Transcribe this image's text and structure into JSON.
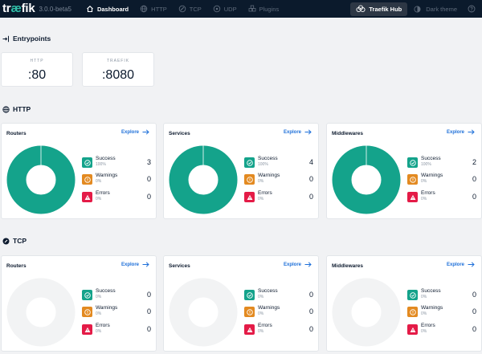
{
  "app": {
    "logo_main": "tr",
    "logo_accent": "æ",
    "logo_rest": "fik",
    "version": "3.0.0-beta5"
  },
  "nav": [
    {
      "label": "Dashboard",
      "icon": "home-icon",
      "active": true
    },
    {
      "label": "HTTP",
      "icon": "globe-icon",
      "active": false
    },
    {
      "label": "TCP",
      "icon": "tcp-icon",
      "active": false
    },
    {
      "label": "UDP",
      "icon": "udp-icon",
      "active": false
    },
    {
      "label": "Plugins",
      "icon": "plugins-icon",
      "active": false
    }
  ],
  "right_nav": {
    "hub_label": "Traefik Hub",
    "theme_label": "Dark theme",
    "help_icon": "help-icon"
  },
  "entrypoints": {
    "title": "Entrypoints",
    "items": [
      {
        "name": "HTTP",
        "value": ":80"
      },
      {
        "name": "TRAEFIK",
        "value": ":8080"
      }
    ]
  },
  "http": {
    "title": "HTTP",
    "cards": [
      {
        "title": "Routers",
        "explore": "Explore",
        "success": 3,
        "warnings": 0,
        "errors": 0,
        "success_pct": "100%",
        "warnings_pct": "0%",
        "errors_pct": "0%",
        "success_ratio": 1.0
      },
      {
        "title": "Services",
        "explore": "Explore",
        "success": 4,
        "warnings": 0,
        "errors": 0,
        "success_pct": "100%",
        "warnings_pct": "0%",
        "errors_pct": "0%",
        "success_ratio": 1.0
      },
      {
        "title": "Middlewares",
        "explore": "Explore",
        "success": 2,
        "warnings": 0,
        "errors": 0,
        "success_pct": "100%",
        "warnings_pct": "0%",
        "errors_pct": "0%",
        "success_ratio": 1.0
      }
    ]
  },
  "tcp": {
    "title": "TCP",
    "cards": [
      {
        "title": "Routers",
        "explore": "Explore",
        "success": 0,
        "warnings": 0,
        "errors": 0,
        "success_pct": "0%",
        "warnings_pct": "0%",
        "errors_pct": "0%",
        "success_ratio": 0.0
      },
      {
        "title": "Services",
        "explore": "Explore",
        "success": 0,
        "warnings": 0,
        "errors": 0,
        "success_pct": "0%",
        "warnings_pct": "0%",
        "errors_pct": "0%",
        "success_ratio": 0.0
      },
      {
        "title": "Middlewares",
        "explore": "Explore",
        "success": 0,
        "warnings": 0,
        "errors": 0,
        "success_pct": "0%",
        "warnings_pct": "0%",
        "errors_pct": "0%",
        "success_ratio": 0.0
      }
    ]
  },
  "labels": {
    "success": "Success",
    "warnings": "Warnings",
    "errors": "Errors"
  },
  "colors": {
    "success": "#14a38b",
    "warning": "#e38a21",
    "error": "#e41b47",
    "empty": "#f2f3f4",
    "accent": "#1d6fd9",
    "topbar": "#0b1a2c"
  }
}
